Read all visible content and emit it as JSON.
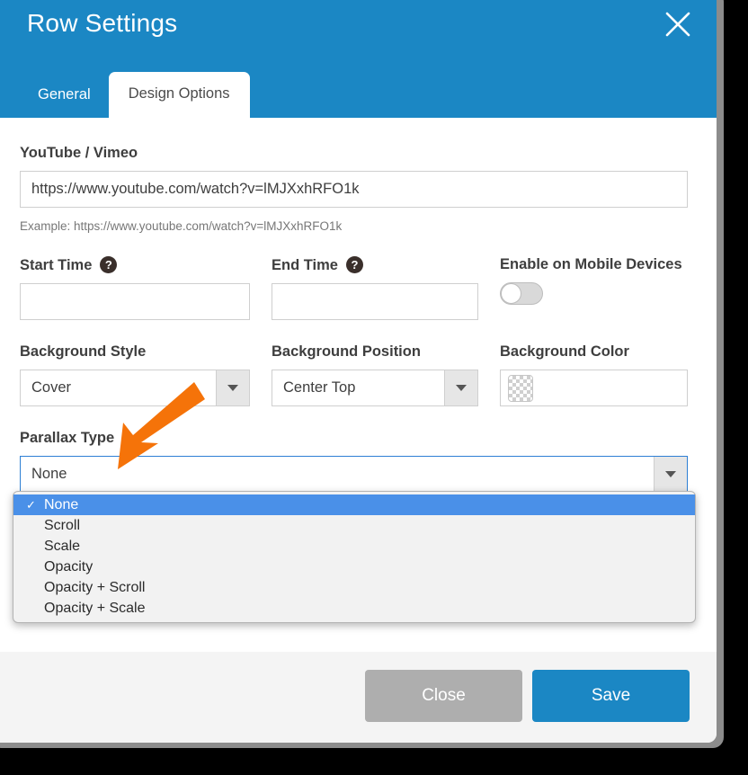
{
  "window": {
    "title": "Row Settings",
    "close_icon": "close-icon"
  },
  "tabs": [
    {
      "label": "General",
      "active": false
    },
    {
      "label": "Design Options",
      "active": true
    }
  ],
  "form": {
    "video": {
      "label": "YouTube / Vimeo",
      "value": "https://www.youtube.com/watch?v=lMJXxhRFO1k",
      "placeholder": "",
      "hint": "Example: https://www.youtube.com/watch?v=lMJXxhRFO1k"
    },
    "start_time": {
      "label": "Start Time",
      "help_icon": "question-mark-icon",
      "value": "",
      "placeholder": ""
    },
    "end_time": {
      "label": "End Time",
      "help_icon": "question-mark-icon",
      "value": "",
      "placeholder": ""
    },
    "mobile": {
      "label": "Enable on Mobile Devices",
      "state": "off"
    },
    "background_style": {
      "label": "Background Style",
      "value": "Cover"
    },
    "background_position": {
      "label": "Background Position",
      "value": "Center Top"
    },
    "background_color": {
      "label": "Background Color",
      "value": "transparent",
      "swatch": "checkerboard"
    },
    "parallax_type": {
      "label": "Parallax Type",
      "value": "None",
      "open": true,
      "options": [
        {
          "label": "None",
          "selected": true
        },
        {
          "label": "Scroll",
          "selected": false
        },
        {
          "label": "Scale",
          "selected": false
        },
        {
          "label": "Opacity",
          "selected": false
        },
        {
          "label": "Opacity + Scroll",
          "selected": false
        },
        {
          "label": "Opacity + Scale",
          "selected": false
        }
      ],
      "checkmark": "✓"
    }
  },
  "footer": {
    "close_label": "Close",
    "save_label": "Save"
  },
  "colors": {
    "brand_blue": "#1b87c4",
    "highlight_blue": "#4a90e8",
    "close_grey": "#aeaeae",
    "annotation_orange": "#f57309",
    "footer_grey": "#f4f4f4"
  },
  "annotation": {
    "arrow": "orange-arrow-pointing-to-parallax-type"
  }
}
